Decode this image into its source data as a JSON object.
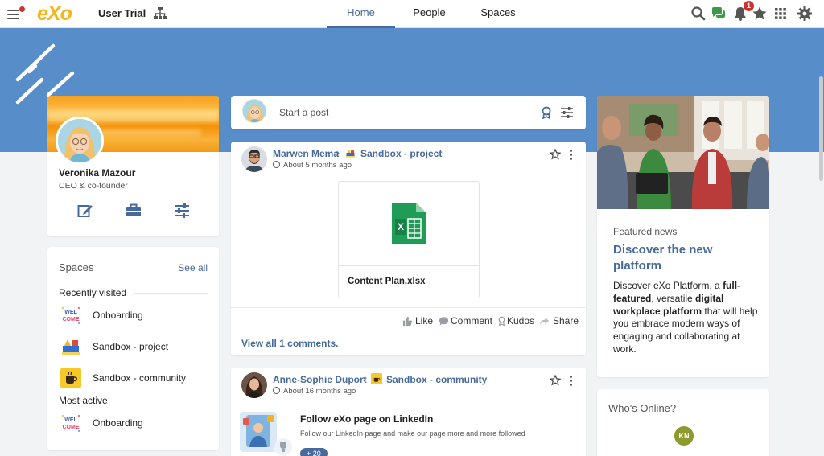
{
  "topbar": {
    "brand": "eXo",
    "company": "User Trial",
    "nav": [
      {
        "label": "Home",
        "active": true
      },
      {
        "label": "People",
        "active": false
      },
      {
        "label": "Spaces",
        "active": false
      }
    ],
    "notifications_count": "1",
    "icons": [
      "hamburger-menu-icon",
      "site-map-icon",
      "search-icon",
      "chat-icon",
      "bell-icon",
      "star-icon",
      "apps-grid-icon",
      "gear-icon"
    ]
  },
  "profile": {
    "name": "Veronika Mazour",
    "title": "CEO & co-founder",
    "actions": [
      "edit-icon",
      "briefcase-icon",
      "settings-sliders-icon"
    ]
  },
  "spaces": {
    "title": "Spaces",
    "see_all": "See all",
    "recent_label": "Recently visited",
    "recent": [
      {
        "name": "Onboarding",
        "icon": "welcome-icon"
      },
      {
        "name": "Sandbox - project",
        "icon": "sandbox-project-icon"
      },
      {
        "name": "Sandbox - community",
        "icon": "coffee-icon"
      }
    ],
    "active_label": "Most active",
    "active": [
      {
        "name": "Onboarding",
        "icon": "welcome-icon"
      }
    ]
  },
  "composer": {
    "placeholder": "Start a post"
  },
  "activity1": {
    "author": "Marwen Mema",
    "space": "Sandbox - project",
    "time": "About 5 months ago",
    "file_name": "Content Plan.xlsx",
    "actions": {
      "like": "Like",
      "comment": "Comment",
      "kudos": "Kudos",
      "share": "Share"
    },
    "view_comments": "View all 1 comments."
  },
  "activity2": {
    "author": "Anne-Sophie Duport",
    "space": "Sandbox - community",
    "time": "About 16 months ago",
    "link_title": "Follow eXo page on LinkedIn",
    "link_desc": "Follow our LinkedIn page and make our page more and more followed",
    "chip": "+ 20"
  },
  "news": {
    "label": "Featured news",
    "title": "Discover the new platform",
    "body_parts": [
      {
        "text": "Discover eXo Platform, a ",
        "bold": false
      },
      {
        "text": "full-featured",
        "bold": true
      },
      {
        "text": ", versatile ",
        "bold": false
      },
      {
        "text": "digital workplace platform",
        "bold": true
      },
      {
        "text": " that will help you embrace modern ways of engaging and collaborating at work.",
        "bold": false
      }
    ]
  },
  "online": {
    "title": "Who's Online?",
    "users": [
      "KN"
    ]
  },
  "colors": {
    "accent": "#476a9c",
    "banner": "#578dc9",
    "notification": "#d0312d",
    "brand": "#f6b519",
    "excel": "#1f9d57",
    "online_avatar": "#8e9a2d"
  }
}
